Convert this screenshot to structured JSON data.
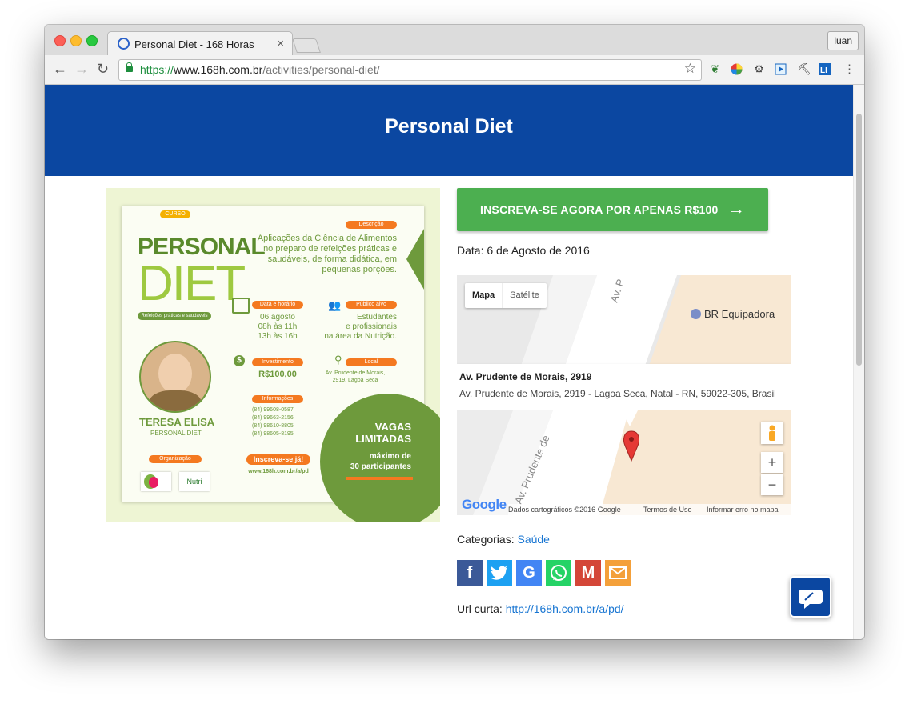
{
  "browser": {
    "tab_title": "Personal Diet - 168 Horas",
    "tab_close": "×",
    "profile": "luan",
    "url_scheme": "https://",
    "url_host": "www.168h.com.br",
    "url_path": "/activities/personal-diet/",
    "back": "←",
    "forward": "→",
    "reload": "↻",
    "star": "☆"
  },
  "hero": {
    "title": "Personal Diet"
  },
  "flyer": {
    "curso": "CURSO",
    "title_a": "PERSONAL",
    "title_b": "DIET",
    "tagline": "Refeições práticas e saudáveis",
    "desc_label": "Descrição",
    "desc": "Aplicações da Ciência de Alimentos no preparo de refeições práticas e saudáveis, de forma didática, em pequenas porções.",
    "date_label": "Data e horário",
    "date_1": "06.agosto",
    "date_2": "08h às 11h",
    "date_3": "13h às 16h",
    "audience_label": "Público alvo",
    "audience_1": "Estudantes",
    "audience_2": "e profissionais",
    "audience_3": "na área da Nutrição.",
    "invest_label": "Investimento",
    "invest": "R$100,00",
    "local_label": "Local",
    "local_1": "Av. Prudente de Morais,",
    "local_2": "2919, Lagoa Seca",
    "info_label": "Informações",
    "phone_1": "(84) 99608-0587",
    "phone_2": "(84) 99663-2156",
    "phone_3": "(84) 98610-8805",
    "phone_4": "(84) 98605-8195",
    "speaker_a": "TERESA ELISA",
    "speaker_b": "PERSONAL DIET",
    "org_label": "Organização",
    "org_logo": "Nutri",
    "cta": "Inscreva-se já!",
    "cta_url": "www.168h.com.br/a/pd",
    "vagas_1": "VAGAS",
    "vagas_2": "LIMITADAS",
    "vagas_3": "máximo de",
    "vagas_4": "30 participantes"
  },
  "signup": {
    "label": "INSCREVA-SE AGORA POR APENAS R$100",
    "arrow": "→"
  },
  "event": {
    "date_label": "Data:",
    "date_value": "6 de Agosto de 2016"
  },
  "map": {
    "type_map": "Mapa",
    "type_sat": "Satélite",
    "poi": "BR Equipadora",
    "street_top": "Av. P",
    "street_bottom": "Av. Prudente de",
    "info_title": "Av. Prudente de Morais, 2919",
    "info_address": "Av. Prudente de Morais, 2919 - Lagoa Seca, Natal - RN, 59022-305, Brasil",
    "zoom_in": "+",
    "zoom_out": "−",
    "google": "Google",
    "attribution": "Dados cartográficos ©2016 Google",
    "terms": "Termos de Uso",
    "report": "Informar erro no mapa"
  },
  "categories": {
    "label": "Categorias:",
    "value": "Saúde"
  },
  "share": {
    "facebook": "f",
    "google": "G",
    "gmail": "M"
  },
  "short_url": {
    "label": "Url curta:",
    "value": "http://168h.com.br/a/pd/"
  },
  "colors": {
    "brand": "#0b47a1",
    "cta": "#4caf50",
    "accent": "#f47920",
    "flyer_green": "#6e9a3c"
  }
}
